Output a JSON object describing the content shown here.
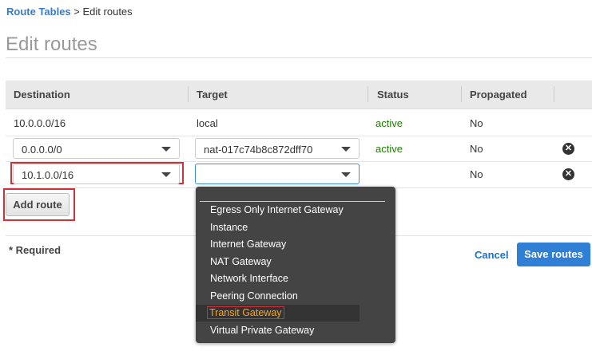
{
  "breadcrumb": {
    "parent": "Route Tables",
    "separator": ">",
    "current": "Edit routes"
  },
  "page_title": "Edit routes",
  "table": {
    "headers": [
      "Destination",
      "Target",
      "Status",
      "Propagated"
    ],
    "rows": [
      {
        "destination": "10.0.0.0/16",
        "target": "local",
        "status": "active",
        "propagated": "No"
      },
      {
        "destination": "0.0.0.0/0",
        "target": "nat-017c74b8c872dff70",
        "status": "active",
        "propagated": "No"
      },
      {
        "destination": "10.1.0.0/16",
        "target": "",
        "status": "",
        "propagated": "No"
      }
    ]
  },
  "add_route": "Add route",
  "required_note": "* Required",
  "cancel": "Cancel",
  "save": "Save routes",
  "dropdown": {
    "options": [
      "Egress Only Internet Gateway",
      "Instance",
      "Internet Gateway",
      "NAT Gateway",
      "Network Interface",
      "Peering Connection",
      "Transit Gateway",
      "Virtual Private Gateway"
    ],
    "highlighted": "Transit Gateway"
  }
}
